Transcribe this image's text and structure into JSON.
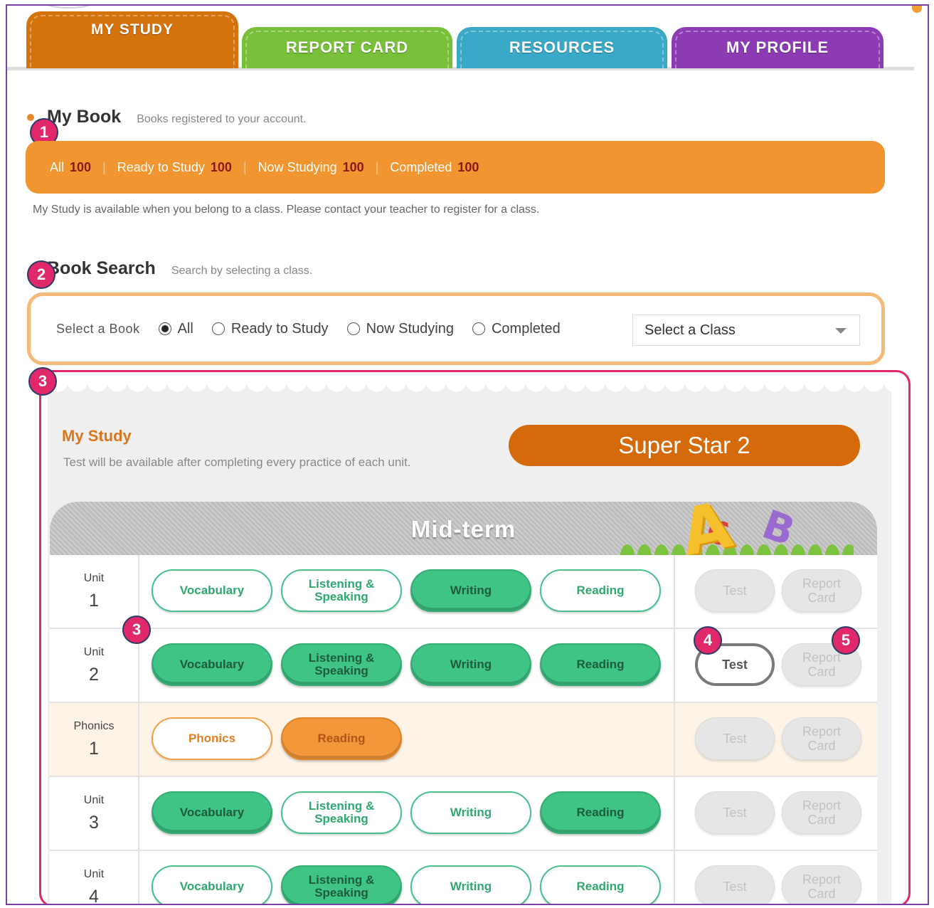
{
  "tabs": [
    {
      "label": "MY STUDY",
      "color": "#d4720c",
      "active": true
    },
    {
      "label": "REPORT CARD",
      "color": "#78c03a"
    },
    {
      "label": "RESOURCES",
      "color": "#3aa9c8"
    },
    {
      "label": "MY PROFILE",
      "color": "#8d3bb5"
    }
  ],
  "my_book": {
    "title": "My Book",
    "subtitle": "Books registered to your account.",
    "stats": [
      {
        "label": "All",
        "value": "100"
      },
      {
        "label": "Ready to Study",
        "value": "100"
      },
      {
        "label": "Now Studying",
        "value": "100"
      },
      {
        "label": "Completed",
        "value": "100"
      }
    ],
    "note": "My Study is available when you belong to a class. Please contact your teacher to register for a class."
  },
  "book_search": {
    "title": "Book Search",
    "subtitle": "Search by selecting a class.",
    "select_label": "Select a Book",
    "options": [
      {
        "label": "All",
        "checked": true
      },
      {
        "label": "Ready to Study",
        "checked": false
      },
      {
        "label": "Now Studying",
        "checked": false
      },
      {
        "label": "Completed",
        "checked": false
      }
    ],
    "class_select": "Select a Class"
  },
  "badges": [
    "1",
    "2",
    "3",
    "3",
    "4",
    "5"
  ],
  "study": {
    "title": "My Study",
    "note": "Test will be available after completing every practice of each unit.",
    "book": "Super Star 2",
    "term": "Mid-term",
    "decor_letters": [
      "A",
      "B",
      "C"
    ],
    "rows": [
      {
        "kind": "Unit",
        "num": "1",
        "activities": [
          {
            "line1": "Vocabulary",
            "line2": "",
            "done": false
          },
          {
            "line1": "Listening &",
            "line2": "Speaking",
            "done": false
          },
          {
            "line1": "Writing",
            "line2": "",
            "done": true
          },
          {
            "line1": "Reading",
            "line2": "",
            "done": false
          }
        ],
        "test": {
          "label": "Test",
          "state": "disabled"
        },
        "report": {
          "line1": "Report",
          "line2": "Card",
          "state": "disabled"
        }
      },
      {
        "kind": "Unit",
        "num": "2",
        "activities": [
          {
            "line1": "Vocabulary",
            "line2": "",
            "done": true
          },
          {
            "line1": "Listening &",
            "line2": "Speaking",
            "done": true
          },
          {
            "line1": "Writing",
            "line2": "",
            "done": true
          },
          {
            "line1": "Reading",
            "line2": "",
            "done": true
          }
        ],
        "test": {
          "label": "Test",
          "state": "active"
        },
        "report": {
          "line1": "Report",
          "line2": "Card",
          "state": "disabled"
        }
      },
      {
        "kind": "Phonics",
        "num": "1",
        "activities": [
          {
            "line1": "Phonics",
            "line2": "",
            "done": false
          },
          {
            "line1": "Reading",
            "line2": "",
            "done": true
          }
        ],
        "test": {
          "label": "Test",
          "state": "disabled"
        },
        "report": {
          "line1": "Report",
          "line2": "Card",
          "state": "disabled"
        }
      },
      {
        "kind": "Unit",
        "num": "3",
        "activities": [
          {
            "line1": "Vocabulary",
            "line2": "",
            "done": true
          },
          {
            "line1": "Listening &",
            "line2": "Speaking",
            "done": false
          },
          {
            "line1": "Writing",
            "line2": "",
            "done": false
          },
          {
            "line1": "Reading",
            "line2": "",
            "done": true
          }
        ],
        "test": {
          "label": "Test",
          "state": "disabled"
        },
        "report": {
          "line1": "Report",
          "line2": "Card",
          "state": "disabled"
        }
      },
      {
        "kind": "Unit",
        "num": "4",
        "activities": [
          {
            "line1": "Vocabulary",
            "line2": "",
            "done": false
          },
          {
            "line1": "Listening &",
            "line2": "Speaking",
            "done": true
          },
          {
            "line1": "Writing",
            "line2": "",
            "done": false
          },
          {
            "line1": "Reading",
            "line2": "",
            "done": false
          }
        ],
        "test": {
          "label": "Test",
          "state": "disabled"
        },
        "report": {
          "line1": "Report",
          "line2": "Card",
          "state": "disabled"
        }
      }
    ]
  }
}
